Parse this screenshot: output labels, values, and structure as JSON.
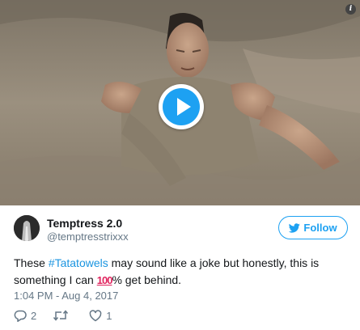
{
  "media": {
    "icons": {
      "play": "play-icon",
      "info": "info-icon"
    },
    "colors": {
      "play": "#1da1f2",
      "sand": "#9b907f"
    }
  },
  "author": {
    "display_name": "Temptress 2.0",
    "handle": "@temptresstrixxx"
  },
  "follow": {
    "label": "Follow",
    "icon": "twitter-bird-icon",
    "color": "#1da1f2"
  },
  "tweet": {
    "text_before": "These ",
    "hashtag": "#Tatatowels",
    "text_middle": " may sound like a joke but honestly, this is something I can ",
    "emoji": "100",
    "text_after": "% get behind.",
    "timestamp": "1:04 PM - Aug 4, 2017"
  },
  "actions": {
    "reply_count": "2",
    "retweet_count": "",
    "like_count": "1",
    "icons": {
      "reply": "reply-icon",
      "retweet": "retweet-icon",
      "like": "heart-icon"
    }
  }
}
